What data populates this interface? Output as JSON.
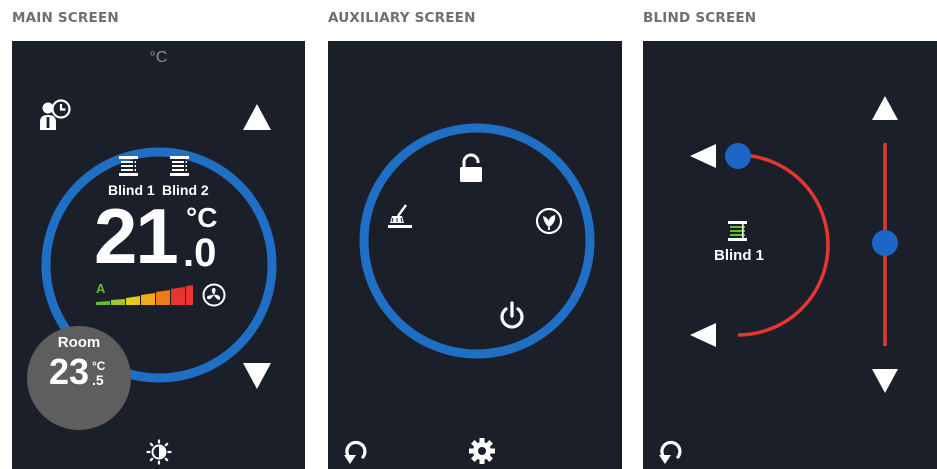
{
  "titles": {
    "main": "MAIN SCREEN",
    "auxiliary": "AUXILIARY SCREEN",
    "blind": "BLIND SCREEN"
  },
  "main_screen": {
    "unit_top": "°C",
    "blind_1_label": "Blind 1",
    "blind_2_label": "Blind 2",
    "temp_integer": "21",
    "temp_unit": "°C",
    "temp_decimal": ".0",
    "fan_mode_label": "A",
    "fan_level_bars": 7,
    "room_label": "Room",
    "room_integer": "23",
    "room_unit": "°C",
    "room_decimal": ".5",
    "icons": [
      "person-clock-icon",
      "up-arrow-icon",
      "blind-icon",
      "fan-icon",
      "down-arrow-icon",
      "brightness-icon"
    ]
  },
  "aux_screen": {
    "icons": [
      "unlock-icon",
      "cleaning-icon",
      "eco-leaf-icon",
      "power-icon",
      "undo-icon",
      "gear-icon"
    ]
  },
  "blind_screen": {
    "blind_label": "Blind 1",
    "icons": [
      "left-arrow-icon",
      "blind-icon",
      "up-arrow-icon",
      "down-arrow-icon",
      "undo-icon"
    ]
  },
  "colors": {
    "panel_bg": "#1b1f2a",
    "ring_blue": "#1f6fc5",
    "slider_red": "#e6362f",
    "knob_blue": "#1d66c6",
    "room_badge": "#5e5e5e",
    "title_gray": "#6f6f6f"
  }
}
